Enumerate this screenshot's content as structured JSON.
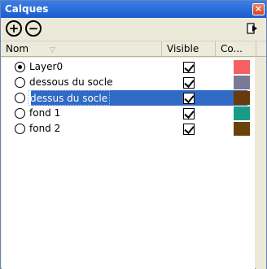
{
  "window": {
    "title": "Calques",
    "close_glyph": "×"
  },
  "toolbar": {
    "add_glyph": "+",
    "remove_glyph": "−",
    "export_icon": "export-icon"
  },
  "table": {
    "columns": [
      "Nom",
      "Visible",
      "Co..."
    ],
    "sort_indicator": "▽",
    "rows": [
      {
        "name": "Layer0",
        "active": true,
        "visible": true,
        "color": "#f56060",
        "selected": false
      },
      {
        "name": "dessous du socle",
        "active": false,
        "visible": true,
        "color": "#7a7a96",
        "selected": false
      },
      {
        "name": "dessus du socle",
        "active": false,
        "visible": true,
        "color": "#6a3a08",
        "selected": true
      },
      {
        "name": "fond 1",
        "active": false,
        "visible": true,
        "color": "#1b9a8a",
        "selected": false
      },
      {
        "name": "fond 2",
        "active": false,
        "visible": true,
        "color": "#6a4208",
        "selected": false
      }
    ]
  }
}
